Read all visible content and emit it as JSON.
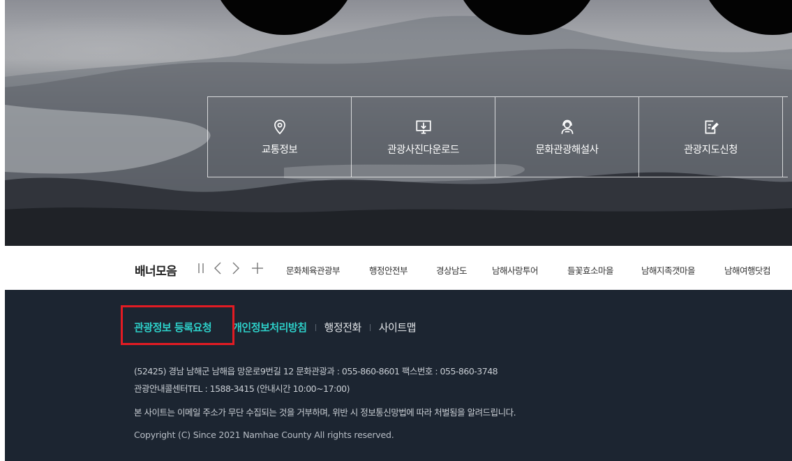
{
  "quick_menu": [
    {
      "label": "교통정보",
      "icon": "map-pin-icon"
    },
    {
      "label": "관광사진다운로드",
      "icon": "monitor-download-icon"
    },
    {
      "label": "문화관광해설사",
      "icon": "guide-headset-icon"
    },
    {
      "label": "관광지도신청",
      "icon": "edit-document-icon"
    }
  ],
  "banner": {
    "title": "배너모음",
    "controls": {
      "pause": "pause-icon",
      "prev": "chevron-left-icon",
      "next": "chevron-right-icon",
      "more": "plus-icon"
    },
    "links": [
      "문화체육관광부",
      "행정안전부",
      "경상남도",
      "남해사랑투어",
      "들꽃효소마을",
      "남해지족갯마을",
      "남해여행닷컴"
    ]
  },
  "footer": {
    "nav": {
      "register": "관광정보 등록요청",
      "privacy": "개인정보처리방침",
      "admin_phone": "행정전화",
      "sitemap": "사이트맵"
    },
    "address_line": "(52425) 경남 남해군 남해읍 망운로9번길 12   문화관광과 : 055-860-8601   팩스번호 : 055-860-3748",
    "callcenter_line": "관광안내콜센터TEL : 1588-3415 (안내시간 10:00~17:00)",
    "notice_line": "본 사이트는 이메일 주소가 무단 수집되는 것을 거부하며, 위반 시 정보통신망법에 따라 처벌됨을 알려드립니다.",
    "copyright": "Copyright (C) Since 2021 Namhae County All rights reserved."
  },
  "colors": {
    "footer_bg": "#1c2531",
    "footer_accent": "#2dd0c9",
    "highlight": "#e31b23"
  }
}
